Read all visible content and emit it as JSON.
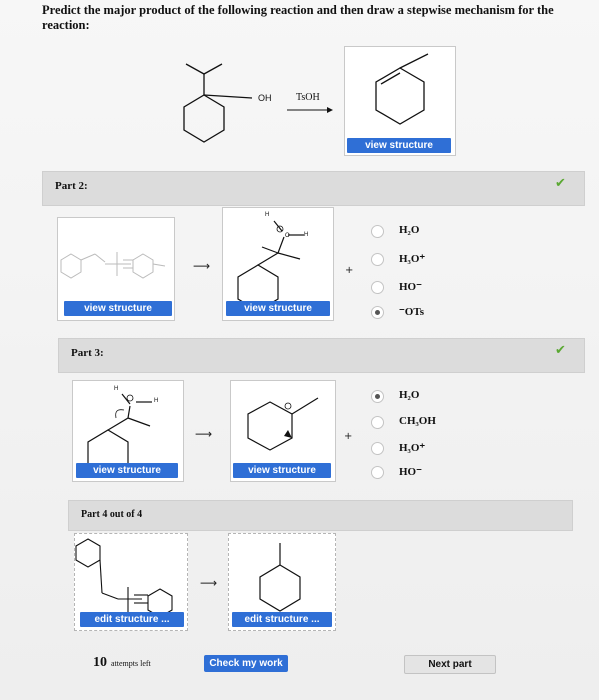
{
  "question": "Predict the major product of the following reaction and then draw a stepwise mechanism for the reaction:",
  "reaction": {
    "oh_label": "OH",
    "reagent": "TsOH",
    "view_label": "view structure"
  },
  "part2": {
    "title": "Part 2:",
    "view1": "view structure",
    "view2": "view structure",
    "h_label": "H",
    "h_label2": "H",
    "plus": "+",
    "options": [
      "H₂O",
      "H₃O⁺",
      "HO⁻",
      "⁻OTs"
    ],
    "selected": 3
  },
  "part3": {
    "title": "Part 3:",
    "view1": "view structure",
    "view2": "view structure",
    "h_label": "H",
    "h_label2": "H",
    "plus": "+",
    "options": [
      "H₂O",
      "CH₃OH",
      "H₃O⁺",
      "HO⁻"
    ],
    "selected": 0
  },
  "part4": {
    "title": "Part 4 out of 4",
    "edit1": "edit structure ...",
    "edit2": "edit structure ..."
  },
  "footer": {
    "attempts_count": "10",
    "attempts_label": "attempts left",
    "check_label": "Check my work",
    "next_label": "Next part"
  },
  "colors": {
    "button": "#2f6fd6",
    "check": "#5aa832",
    "bar": "#dcdcdc"
  }
}
